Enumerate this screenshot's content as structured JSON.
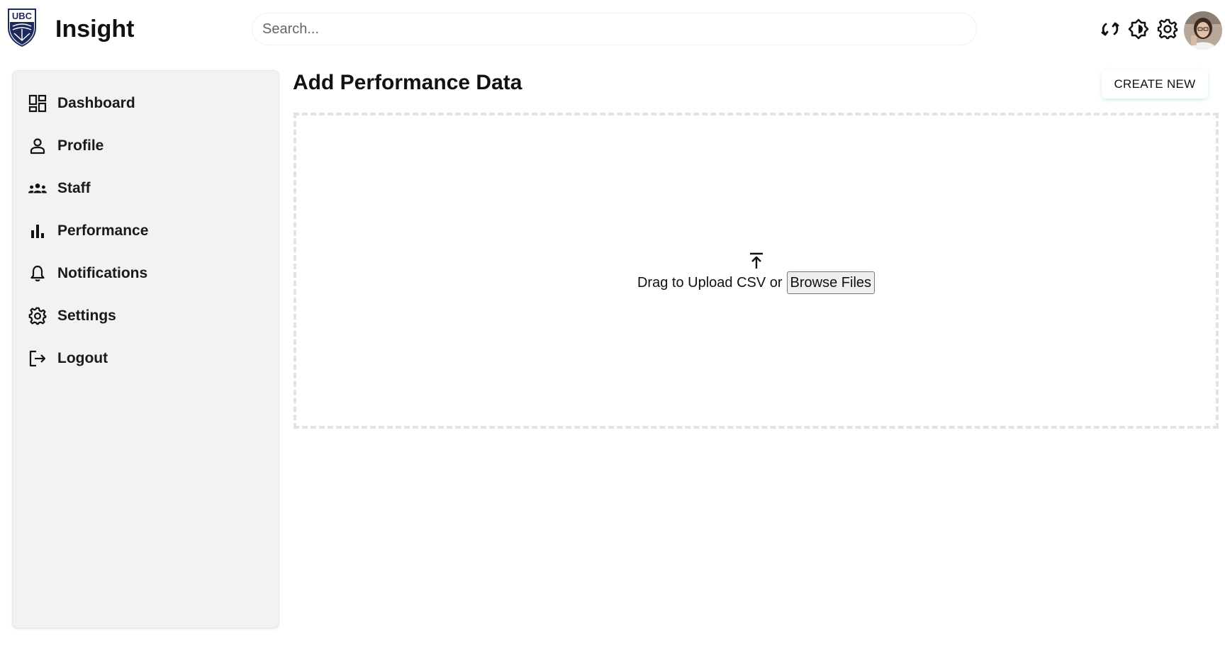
{
  "header": {
    "logo_text": "UBC",
    "brand": "Insight",
    "search_placeholder": "Search...",
    "icons": [
      "refresh-icon",
      "brightness-icon",
      "gear-icon"
    ],
    "avatar": "user-avatar"
  },
  "sidebar": {
    "items": [
      {
        "label": "Dashboard",
        "icon": "dashboard-icon"
      },
      {
        "label": "Profile",
        "icon": "person-icon"
      },
      {
        "label": "Staff",
        "icon": "group-icon"
      },
      {
        "label": "Performance",
        "icon": "bar-chart-icon"
      },
      {
        "label": "Notifications",
        "icon": "bell-icon"
      },
      {
        "label": "Settings",
        "icon": "gear-icon"
      },
      {
        "label": "Logout",
        "icon": "logout-icon"
      }
    ]
  },
  "main": {
    "title": "Add Performance Data",
    "create_button": "CREATE NEW",
    "upload": {
      "text": "Drag to Upload CSV or",
      "browse_button": "Browse Files"
    }
  },
  "colors": {
    "logo_navy": "#1f2a5c",
    "sidebar_bg": "#f2f2f2",
    "dropzone_border": "#e3e3e3"
  }
}
